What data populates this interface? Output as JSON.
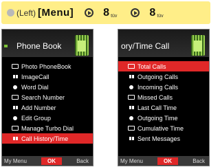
{
  "banner": {
    "left_label": "(Left)",
    "menu_label": "[Menu]",
    "key1": {
      "number": "8",
      "sub": "tüv"
    },
    "key2": {
      "number": "8",
      "sub": "tüv"
    }
  },
  "screen1": {
    "title": "Phone Book",
    "items": [
      {
        "label": "Photo PhoneBook",
        "icon": "photo-phonebook-icon",
        "selected": false
      },
      {
        "label": "ImageCall",
        "icon": "image-call-icon",
        "selected": false
      },
      {
        "label": "Word Dial",
        "icon": "word-dial-icon",
        "selected": false
      },
      {
        "label": "Search Number",
        "icon": "search-icon",
        "selected": false
      },
      {
        "label": "Add Number",
        "icon": "add-number-icon",
        "selected": false
      },
      {
        "label": "Edit Group",
        "icon": "edit-group-icon",
        "selected": false
      },
      {
        "label": "Manage Turbo Dial",
        "icon": "turbo-dial-icon",
        "selected": false
      },
      {
        "label": "Call History/Time",
        "icon": "call-history-icon",
        "selected": true
      }
    ],
    "softkeys": {
      "left": "My Menu",
      "center": "OK",
      "right": "Back"
    }
  },
  "screen2": {
    "title": "ory/Time    Call",
    "items": [
      {
        "label": "Total Calls",
        "icon": "total-calls-icon",
        "selected": true
      },
      {
        "label": "Outgoing Calls",
        "icon": "outgoing-calls-icon",
        "selected": false
      },
      {
        "label": "Incoming Calls",
        "icon": "incoming-calls-icon",
        "selected": false
      },
      {
        "label": "Missed Calls",
        "icon": "missed-calls-icon",
        "selected": false
      },
      {
        "label": "Last Call Time",
        "icon": "last-call-time-icon",
        "selected": false
      },
      {
        "label": "Outgoing Time",
        "icon": "outgoing-time-icon",
        "selected": false
      },
      {
        "label": "Cumulative Time",
        "icon": "cumulative-time-icon",
        "selected": false
      },
      {
        "label": "Sent Messages",
        "icon": "sent-messages-icon",
        "selected": false
      }
    ],
    "softkeys": {
      "left": "My Menu",
      "center": "OK",
      "right": "Back"
    }
  },
  "colors": {
    "banner_bg": "#ffee88",
    "highlight": "#e02828",
    "screen_bg": "#000000",
    "accent_green": "#7dc238"
  }
}
